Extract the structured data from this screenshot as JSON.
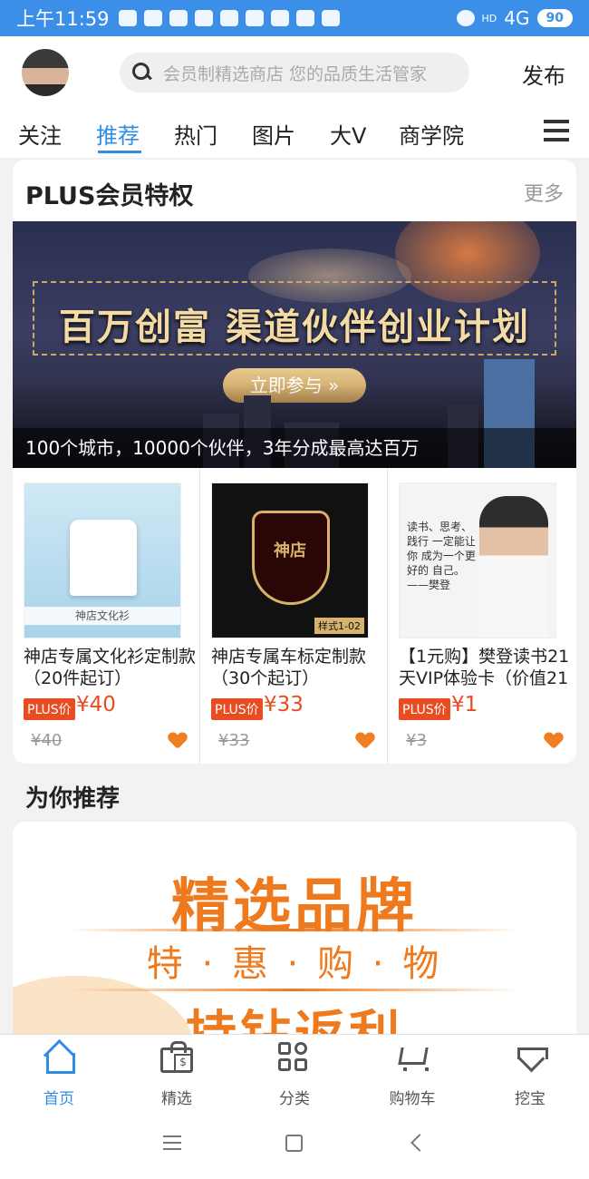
{
  "status_bar": {
    "time": "上午11:59",
    "network": "4G",
    "network_prefix": "HD",
    "battery": "90"
  },
  "header": {
    "search_placeholder": "会员制精选商店 您的品质生活管家",
    "publish_label": "发布"
  },
  "tabs": [
    {
      "label": "关注"
    },
    {
      "label": "推荐",
      "active": true
    },
    {
      "label": "热门"
    },
    {
      "label": "图片"
    },
    {
      "label": "大V"
    },
    {
      "label": "商学院"
    }
  ],
  "plus_section": {
    "title": "PLUS会员特权",
    "more_label": "更多",
    "banner": {
      "headline": "百万创富 渠道伙伴创业计划",
      "button_label": "立即参与 »",
      "caption": "100个城市，10000个伙伴，3年分成最高达百万"
    },
    "products": [
      {
        "name": "神店专属文化衫定制款（20件起订）",
        "badge": "PLUS价",
        "price": "¥40",
        "original_price": "¥40",
        "image_text": "神店文化衫"
      },
      {
        "name": "神店专属车标定制款（30个起订）",
        "badge": "PLUS价",
        "price": "¥33",
        "original_price": "¥33",
        "image_text": "神店",
        "image_tag": "样式1-02"
      },
      {
        "name": "【1元购】樊登读书21天VIP体验卡（价值21",
        "badge": "PLUS价",
        "price": "¥1",
        "original_price": "¥3",
        "image_text": "读书、思考、践行 一定能让你 成为一个更好的 自己。 ——樊登"
      }
    ]
  },
  "recommend_section": {
    "title": "为你推荐",
    "promo": {
      "headline": "精选品牌",
      "subline": "特 · 惠 · 购 · 物",
      "tagline": "持钻返利"
    }
  },
  "bottom_nav": [
    {
      "label": "首页",
      "icon": "home-icon",
      "active": true
    },
    {
      "label": "精选",
      "icon": "shopping-bag-icon"
    },
    {
      "label": "分类",
      "icon": "category-grid-icon"
    },
    {
      "label": "购物车",
      "icon": "cart-icon"
    },
    {
      "label": "挖宝",
      "icon": "diamond-icon"
    }
  ],
  "colors": {
    "accent": "#2f8de4",
    "status_bar": "#3b8fe8",
    "price": "#e84c20",
    "promo": "#ef7a1e"
  }
}
